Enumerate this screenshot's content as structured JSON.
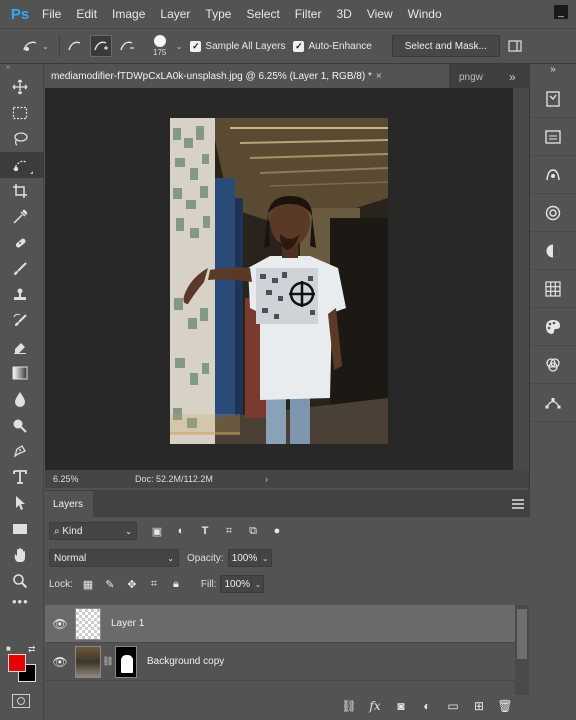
{
  "app": {
    "logo": "Ps",
    "window_button": "_"
  },
  "menu": [
    "File",
    "Edit",
    "Image",
    "Layer",
    "Type",
    "Select",
    "Filter",
    "3D",
    "View",
    "Windo"
  ],
  "options": {
    "brush_size": "175",
    "sample_all_layers": "Sample All Layers",
    "auto_enhance": "Auto-Enhance",
    "select_and_mask": "Select and Mask..."
  },
  "document": {
    "tab_title": "mediamodifier-fTDWpCxLA0k-unsplash.jpg @ 6.25% (Layer 1, RGB/8) *",
    "tab_close": "×",
    "second_tab": "pngw",
    "more_tabs": "»"
  },
  "status": {
    "zoom": "6.25%",
    "doc": "Doc: 52.2M/112.2M",
    "arrow": "›"
  },
  "layers_panel": {
    "tab": "Layers",
    "kind": "Kind",
    "blend_mode": "Normal",
    "opacity_label": "Opacity:",
    "opacity": "100%",
    "lock_label": "Lock:",
    "fill_label": "Fill:",
    "fill": "100%",
    "layers": [
      {
        "name": "Layer 1",
        "selected": true
      },
      {
        "name": "Background copy",
        "selected": false
      }
    ]
  },
  "colors": {
    "foreground": "#e60000",
    "background": "#000000",
    "accent": "#31a8ff"
  },
  "icons": {
    "toolbar": [
      "move-icon",
      "marquee-icon",
      "lasso-icon",
      "quick-selection-icon",
      "crop-icon",
      "eyedropper-icon",
      "healing-brush-icon",
      "brush-icon",
      "clone-stamp-icon",
      "history-brush-icon",
      "eraser-icon",
      "gradient-icon",
      "blur-icon",
      "dodge-icon",
      "pen-icon",
      "type-icon",
      "path-selection-icon",
      "rectangle-icon",
      "hand-icon",
      "zoom-icon",
      "more-tools-icon"
    ],
    "dock": [
      "history-icon",
      "properties-icon",
      "adjustments-icon",
      "libraries-icon",
      "color-icon",
      "swatches-icon",
      "styles-icon",
      "channels-icon",
      "paths-icon"
    ]
  }
}
